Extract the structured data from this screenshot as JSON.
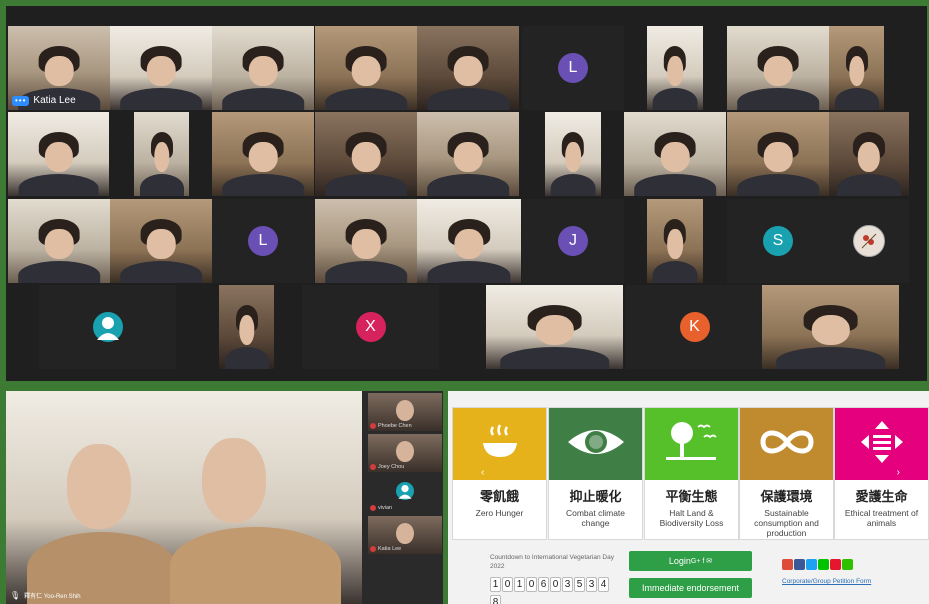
{
  "gallery": {
    "tiles": [
      {
        "kind": "photo",
        "name": "Katia Lee",
        "showLabel": true
      },
      {
        "kind": "photo"
      },
      {
        "kind": "photo"
      },
      {
        "kind": "photo"
      },
      {
        "kind": "photo"
      },
      {
        "kind": "avatar",
        "letter": "L",
        "color": "#6a4fb5"
      },
      {
        "kind": "photo"
      },
      {
        "kind": "photo"
      },
      {
        "kind": "photo"
      },
      {
        "kind": "photo"
      },
      {
        "kind": "photo"
      },
      {
        "kind": "photo"
      },
      {
        "kind": "photo"
      },
      {
        "kind": "photo"
      },
      {
        "kind": "photo"
      },
      {
        "kind": "photo"
      },
      {
        "kind": "photo"
      },
      {
        "kind": "photo"
      },
      {
        "kind": "photo"
      },
      {
        "kind": "photo"
      },
      {
        "kind": "avatar",
        "letter": "L",
        "color": "#6a4fb5"
      },
      {
        "kind": "photo"
      },
      {
        "kind": "photo"
      },
      {
        "kind": "avatar",
        "letter": "J",
        "color": "#6a4fb5"
      },
      {
        "kind": "photo"
      },
      {
        "kind": "avatar",
        "letter": "S",
        "color": "#1aa1b0"
      },
      {
        "kind": "image-avatar"
      },
      {
        "kind": "avatar",
        "letter": "",
        "color": "#1aa1b0",
        "person": true
      },
      {
        "kind": "photo"
      },
      {
        "kind": "avatar",
        "letter": "X",
        "color": "#d6235e"
      },
      {
        "kind": "photo"
      },
      {
        "kind": "avatar",
        "letter": "K",
        "color": "#e8602c"
      },
      {
        "kind": "photo"
      }
    ]
  },
  "speaker": {
    "name_label": "釋有仁 Yoo-Ren Shih",
    "thumbnails": [
      {
        "name": "Phoebe Chen"
      },
      {
        "name": "Joey Chou"
      },
      {
        "name": "vivian"
      },
      {
        "name": "Katia Lee"
      }
    ]
  },
  "webpage": {
    "cards": [
      {
        "zh": "零飢餓",
        "en": "Zero Hunger",
        "color": "#e5b21c",
        "icon": "bowl-icon",
        "arrow": "‹"
      },
      {
        "zh": "抑止暖化",
        "en": "Combat climate change",
        "color": "#3f7e44",
        "icon": "earth-eye-icon"
      },
      {
        "zh": "平衡生態",
        "en": "Halt Land & Biodiversity Loss",
        "color": "#56c02b",
        "icon": "tree-birds-icon"
      },
      {
        "zh": "保護環境",
        "en": "Sustainable consumption and production",
        "color": "#bf8b2e",
        "icon": "infinity-icon"
      },
      {
        "zh": "愛護生命",
        "en": "Ethical treatment of animals",
        "color": "#e5007d",
        "icon": "arrows-icon",
        "arrow": "›"
      }
    ],
    "countdown": {
      "title": "Countdown to International Vegetarian Day 2022",
      "digits": [
        "1",
        "0",
        "1",
        "0",
        "6",
        "0",
        "3",
        "5",
        "3",
        "4",
        "8"
      ]
    },
    "login_label": "Login",
    "login_icons": "G+ f ✉",
    "endorse_label": "Immediate endorsement",
    "petition_link": "Corporate/Group Petition Form",
    "social_colors": [
      "#dd4b39",
      "#3b5998",
      "#1da1f2",
      "#00c300",
      "#e6162d",
      "#2dc100"
    ]
  }
}
